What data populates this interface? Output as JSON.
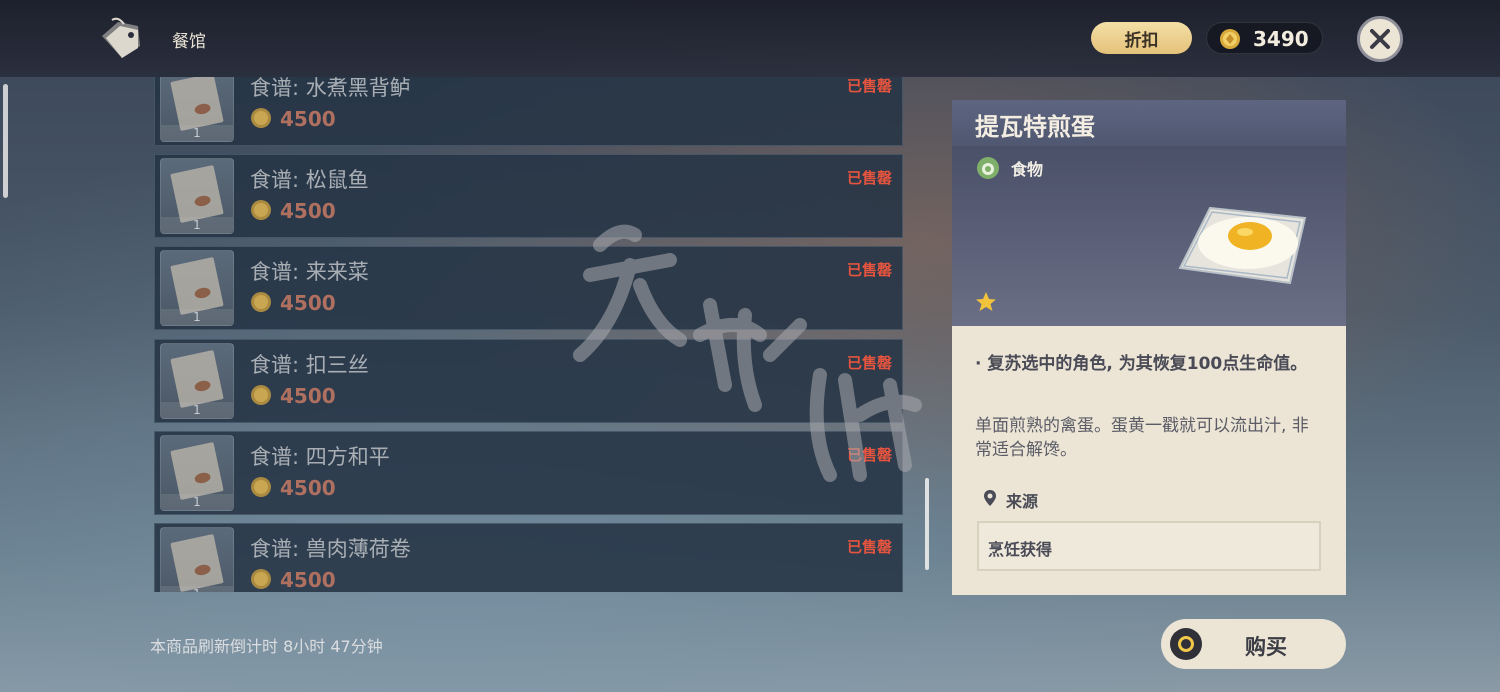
{
  "header": {
    "shop_title": "餐馆",
    "discount_label": "折扣",
    "currency_amount": "3490"
  },
  "shop_items": [
    {
      "name": "食谱: 水煮黑背鲈",
      "price": "4500",
      "quantity": "1",
      "status": "已售罄"
    },
    {
      "name": "食谱: 松鼠鱼",
      "price": "4500",
      "quantity": "1",
      "status": "已售罄"
    },
    {
      "name": "食谱: 来来菜",
      "price": "4500",
      "quantity": "1",
      "status": "已售罄"
    },
    {
      "name": "食谱: 扣三丝",
      "price": "4500",
      "quantity": "1",
      "status": "已售罄"
    },
    {
      "name": "食谱: 四方和平",
      "price": "4500",
      "quantity": "1",
      "status": "已售罄"
    },
    {
      "name": "食谱: 兽肉薄荷卷",
      "price": "4500",
      "quantity": "1",
      "status": "已售罄"
    }
  ],
  "refresh_text": "本商品刷新倒计时 8小时 47分钟",
  "detail": {
    "title": "提瓦特煎蛋",
    "type": "食物",
    "rarity": 1,
    "effect": "· 复苏选中的角色, 为其恢复100点生命值。",
    "description": "单面煎熟的禽蛋。蛋黄一戳就可以流出汁, 非常适合解馋。",
    "source_label": "来源",
    "source_value": "烹饪获得"
  },
  "buy_label": "购买",
  "colors": {
    "sold_out": "#e5543e",
    "price": "#b07060",
    "discount_bg": "#f3dfa6",
    "panel_bg": "#ece5d6",
    "detail_header": "#5d6580"
  }
}
